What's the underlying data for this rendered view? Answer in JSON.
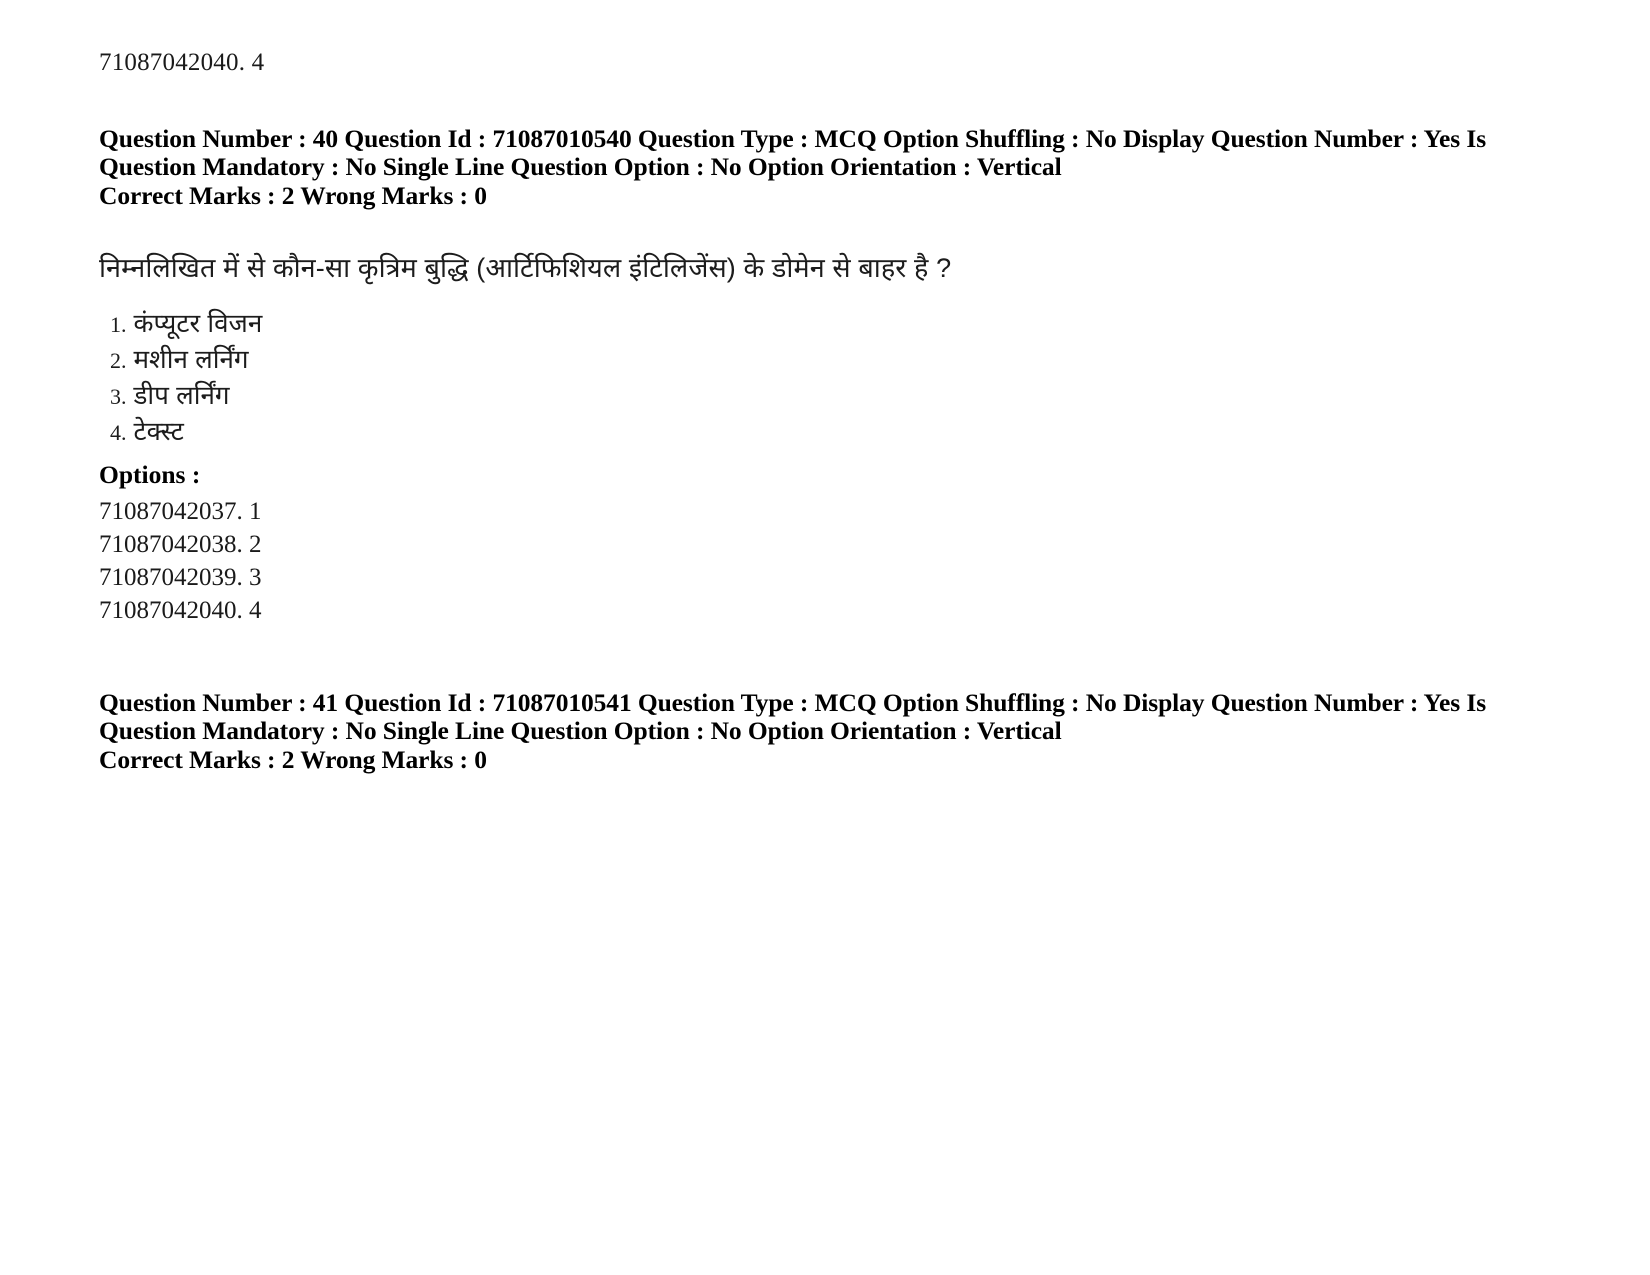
{
  "page": {
    "top_reference_line": "71087042040. 4"
  },
  "questions": [
    {
      "meta_line_1": "Question Number : 40 Question Id : 71087010540 Question Type : MCQ Option Shuffling : No Display Question Number : Yes Is",
      "meta_line_2": "Question Mandatory : No Single Line Question Option : No Option Orientation : Vertical",
      "marks_line": "Correct Marks : 2 Wrong Marks : 0",
      "question_text": "निम्नलिखित में से कौन-सा कृत्रिम बुद्धि (आर्टिफिशियल इंटिलिजेंस) के डोमेन से बाहर है ?",
      "choices": [
        {
          "number": "1.",
          "text": "कंप्यूटर विजन"
        },
        {
          "number": "2.",
          "text": "मशीन लर्निंग"
        },
        {
          "number": "3.",
          "text": "डीप लर्निंग"
        },
        {
          "number": "4.",
          "text": "टेक्स्ट"
        }
      ],
      "options_label": "Options :",
      "option_ids": [
        "71087042037. 1",
        "71087042038. 2",
        "71087042039. 3",
        "71087042040. 4"
      ]
    },
    {
      "meta_line_1": "Question Number : 41 Question Id : 71087010541 Question Type : MCQ Option Shuffling : No Display Question Number : Yes Is",
      "meta_line_2": "Question Mandatory : No Single Line Question Option : No Option Orientation : Vertical",
      "marks_line": "Correct Marks : 2 Wrong Marks : 0"
    }
  ]
}
